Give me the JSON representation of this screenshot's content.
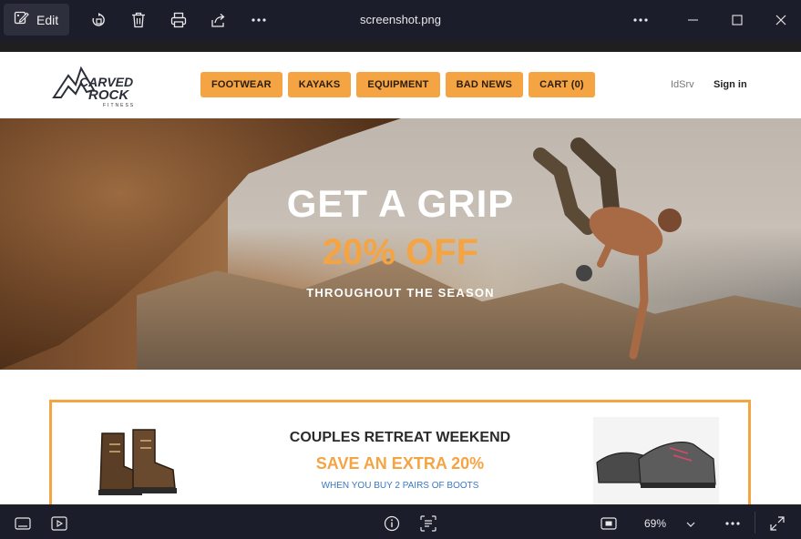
{
  "viewer": {
    "edit_label": "Edit",
    "file_name": "screenshot.png",
    "zoom": "69%"
  },
  "site": {
    "nav": [
      "FOOTWEAR",
      "KAYAKS",
      "EQUIPMENT",
      "BAD NEWS",
      "CART (0)"
    ],
    "idsrv": "IdSrv",
    "sign_in": "Sign in",
    "logo_text": "CARVED ROCK FITNESS"
  },
  "hero": {
    "line1": "GET A GRIP",
    "line2": "20% OFF",
    "line3": "THROUGHOUT THE SEASON"
  },
  "promo": {
    "title": "COUPLES RETREAT WEEKEND",
    "offer": "SAVE AN EXTRA 20%",
    "detail": "WHEN YOU BUY 2 PAIRS OF BOOTS"
  },
  "colors": {
    "accent": "#f5a443",
    "viewer_bar": "#1b1d2a",
    "link_blue": "#3b78c4"
  }
}
